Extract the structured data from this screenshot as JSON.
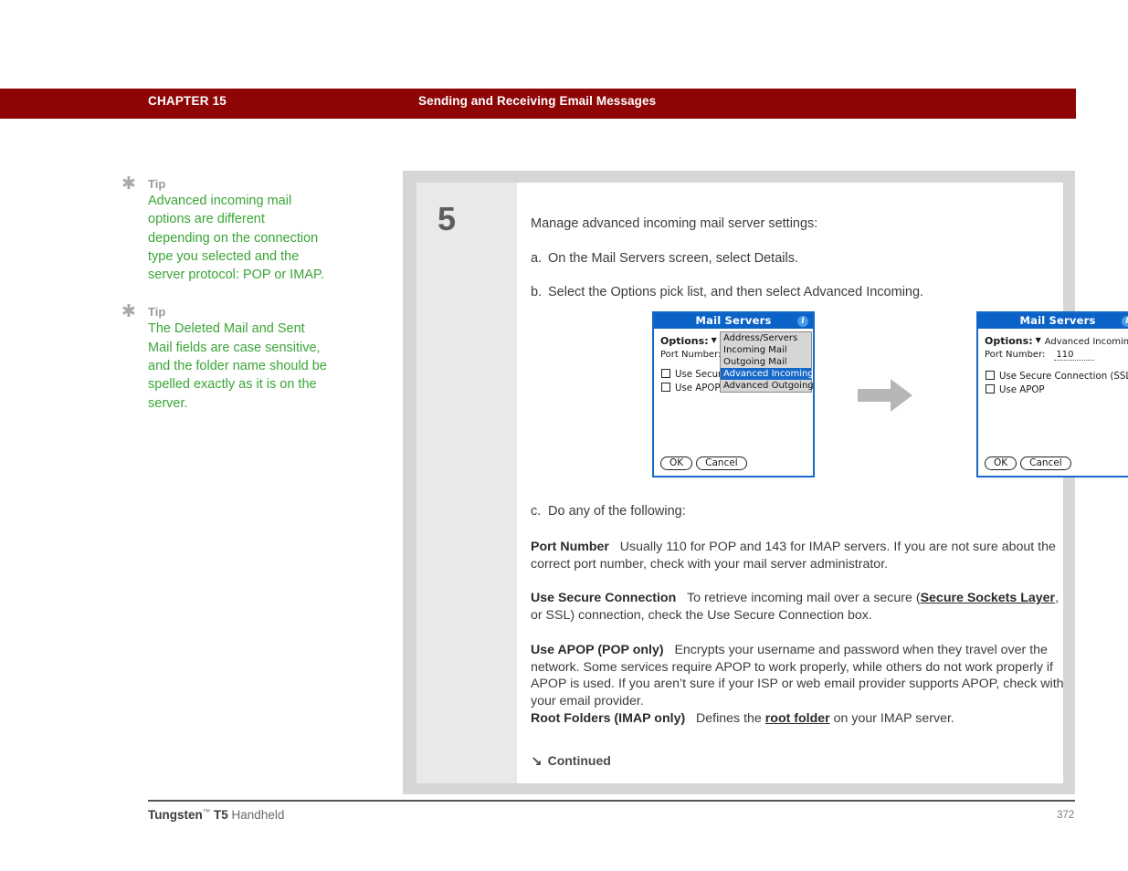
{
  "header": {
    "chapter_label": "CHAPTER 15",
    "title": "Sending and Receiving Email Messages",
    "bar_color": "#8d0505"
  },
  "tips": [
    {
      "icon": "asterisk-icon",
      "heading": "Tip",
      "body": "Advanced incoming mail options are different depending on the connection type you selected and the server protocol: POP or IMAP."
    },
    {
      "icon": "asterisk-icon",
      "heading": "Tip",
      "body": "The Deleted Mail and Sent Mail fields are case sensitive, and the folder name should be spelled exactly as it is on the server."
    }
  ],
  "step": {
    "number": "5",
    "intro": "Manage advanced incoming mail server settings:",
    "substeps": [
      {
        "marker": "a.",
        "text": "On the Mail Servers screen, select Details."
      },
      {
        "marker": "b.",
        "text": "Select the Options pick list, and then select Advanced Incoming."
      },
      {
        "marker": "c.",
        "text": "Do any of the following:"
      }
    ]
  },
  "devices": {
    "left": {
      "title": "Mail Servers",
      "info_icon": "i",
      "options_label": "Options:",
      "port_label": "Port Number:",
      "port_value": "",
      "checkbox_ssl": "Use Secure Connection (SSL)",
      "checkbox_apop": "Use APOP",
      "picklist": [
        {
          "label": "Address/Servers",
          "selected": false
        },
        {
          "label": "Incoming Mail",
          "selected": false
        },
        {
          "label": "Outgoing Mail",
          "selected": false
        },
        {
          "label": "Advanced Incoming",
          "selected": true
        },
        {
          "label": "Advanced Outgoing",
          "selected": false
        }
      ],
      "ok_button": "OK",
      "cancel_button": "Cancel"
    },
    "right": {
      "title": "Mail Servers",
      "info_icon": "i",
      "options_label": "Options:",
      "options_value": "Advanced Incoming",
      "port_label": "Port Number:",
      "port_value": "110",
      "checkbox_ssl": "Use Secure Connection (SSL)",
      "checkbox_apop": "Use APOP",
      "ok_button": "OK",
      "cancel_button": "Cancel"
    },
    "arrow": "right-arrow-icon",
    "titlebar_color": "#0b63c7"
  },
  "definitions": {
    "port": {
      "term": "Port Number",
      "text": "Usually 110 for POP and 143 for IMAP servers. If you are not sure about the correct port number, check with your mail server administrator."
    },
    "ssl": {
      "term": "Use Secure Connection",
      "text_before": "To retrieve incoming mail over a secure (",
      "link": "Secure Sockets Layer",
      "text_after": ", or SSL) connection, check the Use Secure Connection box."
    },
    "apop": {
      "term": "Use APOP (POP only)",
      "text": "Encrypts your username and password when they travel over the network. Some services require APOP to work properly, while others do not work properly if APOP is used. If you aren’t sure if your ISP or web email provider supports APOP, check with your email provider."
    },
    "root": {
      "term": "Root Folders (IMAP only)",
      "text_before": "Defines the ",
      "link": "root folder",
      "text_after": " on your IMAP server."
    },
    "continued": {
      "icon": "continued-arrow-icon",
      "label": "Continued"
    }
  },
  "footer": {
    "product": "Tungsten",
    "trademark": "™",
    "model": "T5",
    "kind": "Handheld",
    "page_number": "372"
  }
}
